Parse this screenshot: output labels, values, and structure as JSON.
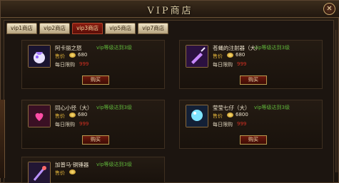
{
  "window": {
    "title": "VIP商店",
    "close_symbol": "✕"
  },
  "tabs": [
    "vip1商店",
    "vip2商店",
    "vip3商店",
    "vip5商店",
    "vip7商店"
  ],
  "active_tab": 2,
  "shared": {
    "price_label": "售价",
    "limit_label": "每日限购",
    "buy_label": "购买"
  },
  "items": [
    {
      "name": "阿卡丽之怒",
      "requirement": "vip等级达到3级",
      "price": "680",
      "limit": "999"
    },
    {
      "name": "苍蝇的注射器（大）",
      "requirement": "vip等级达到3级",
      "price": "680",
      "limit": "999"
    },
    {
      "name": "同心小径（大）",
      "requirement": "vip等级达到3级",
      "price": "680",
      "limit": "999"
    },
    {
      "name": "莹莹七仔（大）",
      "requirement": "vip等级达到3级",
      "price": "6800",
      "limit": "999"
    },
    {
      "name": "加普马·铜锤器",
      "requirement": "vip等级达到3级",
      "price": "",
      "limit": ""
    }
  ],
  "colors": {
    "accent_red": "#8a1c10",
    "gold": "#e1b33a",
    "green": "#5fb43a"
  },
  "icons": [
    "potion-icon",
    "syringe-icon",
    "heart-scroll-icon",
    "blue-orb-icon",
    "staff-icon"
  ]
}
